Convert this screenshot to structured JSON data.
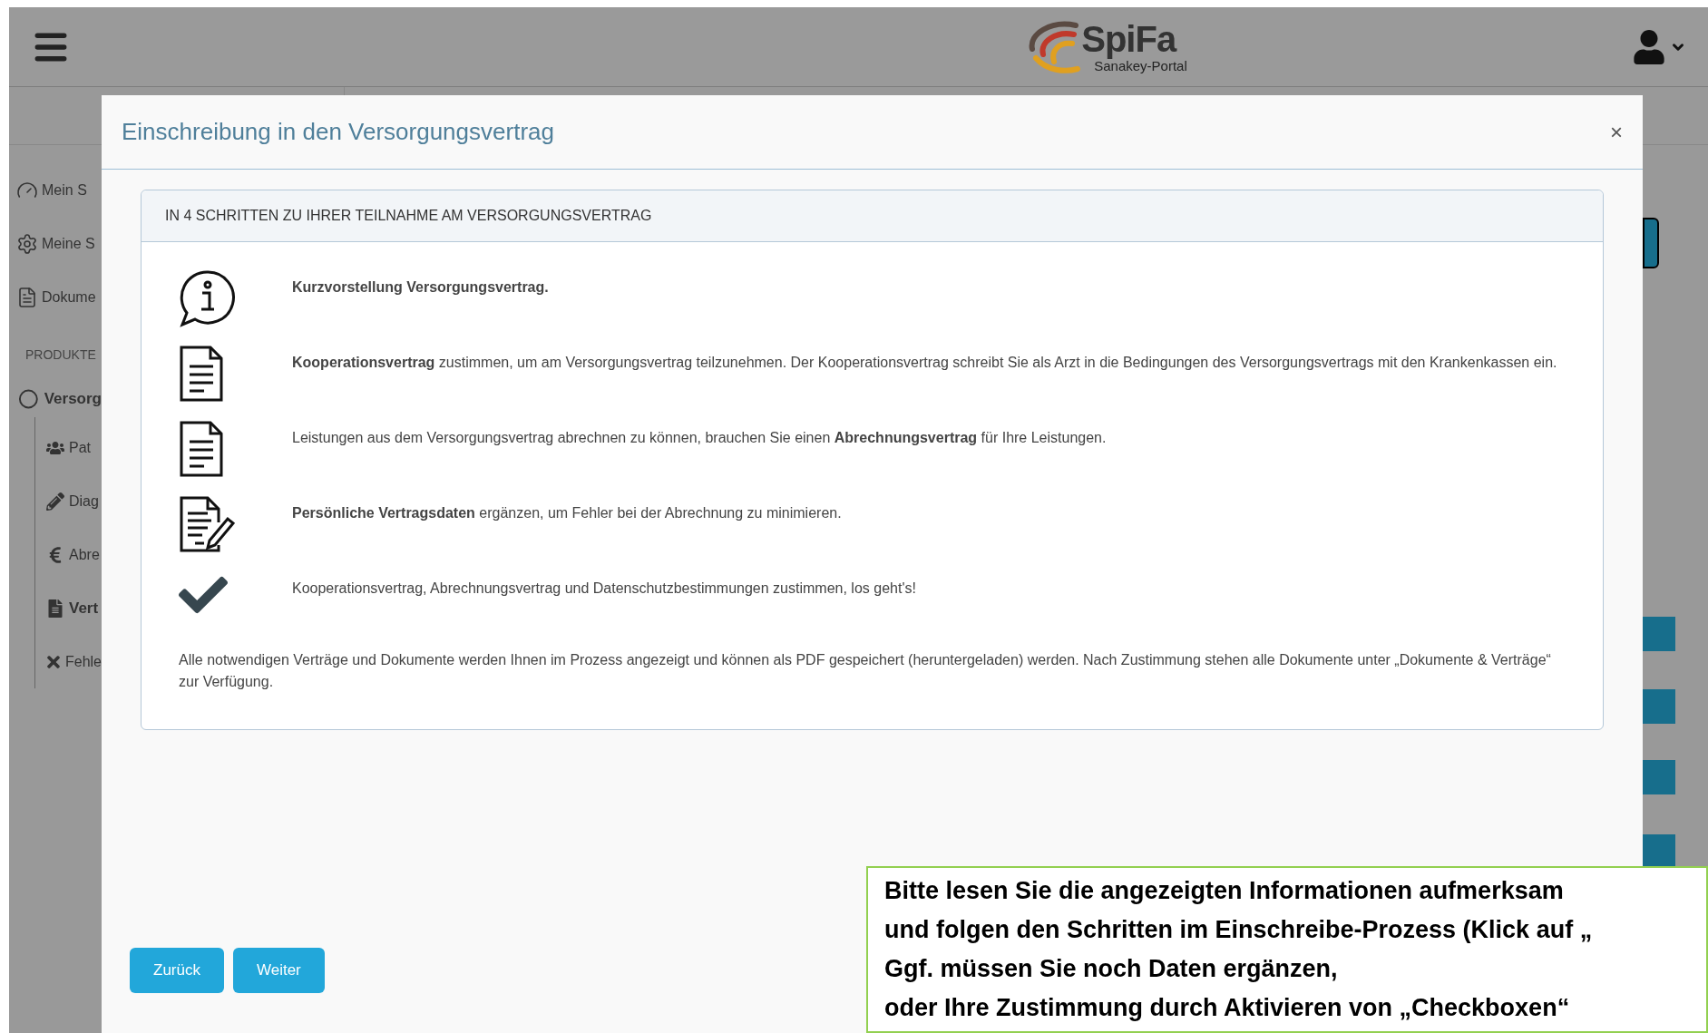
{
  "header": {
    "logo_title": "SpiFa",
    "logo_subtitle": "Sanakey-Portal"
  },
  "sidebar": {
    "items": [
      {
        "label": "Mein S"
      },
      {
        "label": "Meine S"
      },
      {
        "label": "Dokume"
      }
    ],
    "section": "PRODUKTE",
    "product": {
      "label": "Versorg",
      "children": [
        {
          "label": "Pat",
          "selected": false
        },
        {
          "label": "Diag",
          "selected": false
        },
        {
          "label": "Abre",
          "selected": false
        },
        {
          "label": "Vert",
          "selected": true
        },
        {
          "label": "Fehle",
          "selected": false
        }
      ]
    }
  },
  "modal": {
    "title": "Einschreibung in den Versorgungsvertrag",
    "close": "×",
    "panel_heading": "IN 4 SCHRITTEN ZU IHRER TEILNAHME AM VERSORGUNGSVERTRAG",
    "steps": [
      {
        "kind": "info",
        "text": "**Kurzvorstellung Versorgungsvertrag.**"
      },
      {
        "kind": "document",
        "text": "**Kooperationsvertrag** zustimmen, um am Versorgungsvertrag teilzunehmen. Der Kooperationsvertrag schreibt Sie als Arzt in die Bedingungen des Versorgungsvertrags mit den Krankenkassen ein."
      },
      {
        "kind": "document",
        "text": "Leistungen aus dem Versorgungsvertrag abrechnen zu können, brauchen Sie einen **Abrechnungsvertrag** für Ihre Leistungen."
      },
      {
        "kind": "edit",
        "text": "**Persönliche Vertragsdaten** ergänzen, um Fehler bei der Abrechnung zu minimieren."
      },
      {
        "kind": "check",
        "text": "Kooperationsvertrag, Abrechnungsvertrag und Datenschutzbestimmungen zustimmen, los geht's!"
      }
    ],
    "note": "Alle notwendigen Verträge und Dokumente werden Ihnen im Prozess angezeigt und können als PDF gespeichert (heruntergeladen) werden. Nach Zustimmung stehen alle Dokumente unter „Dokumente & Verträge“ zur Verfügung.",
    "buttons": [
      {
        "label": "Zurück"
      },
      {
        "label": "Weiter"
      }
    ]
  },
  "callout": {
    "lines": [
      "Bitte lesen Sie die angezeigten Informationen aufmerksam",
      "und folgen den Schritten im Einschreibe-Prozess (Klick auf „",
      "Ggf. müssen Sie noch Daten ergänzen,",
      "oder Ihre Zustimmung durch Aktivieren von „Checkboxen“"
    ]
  }
}
